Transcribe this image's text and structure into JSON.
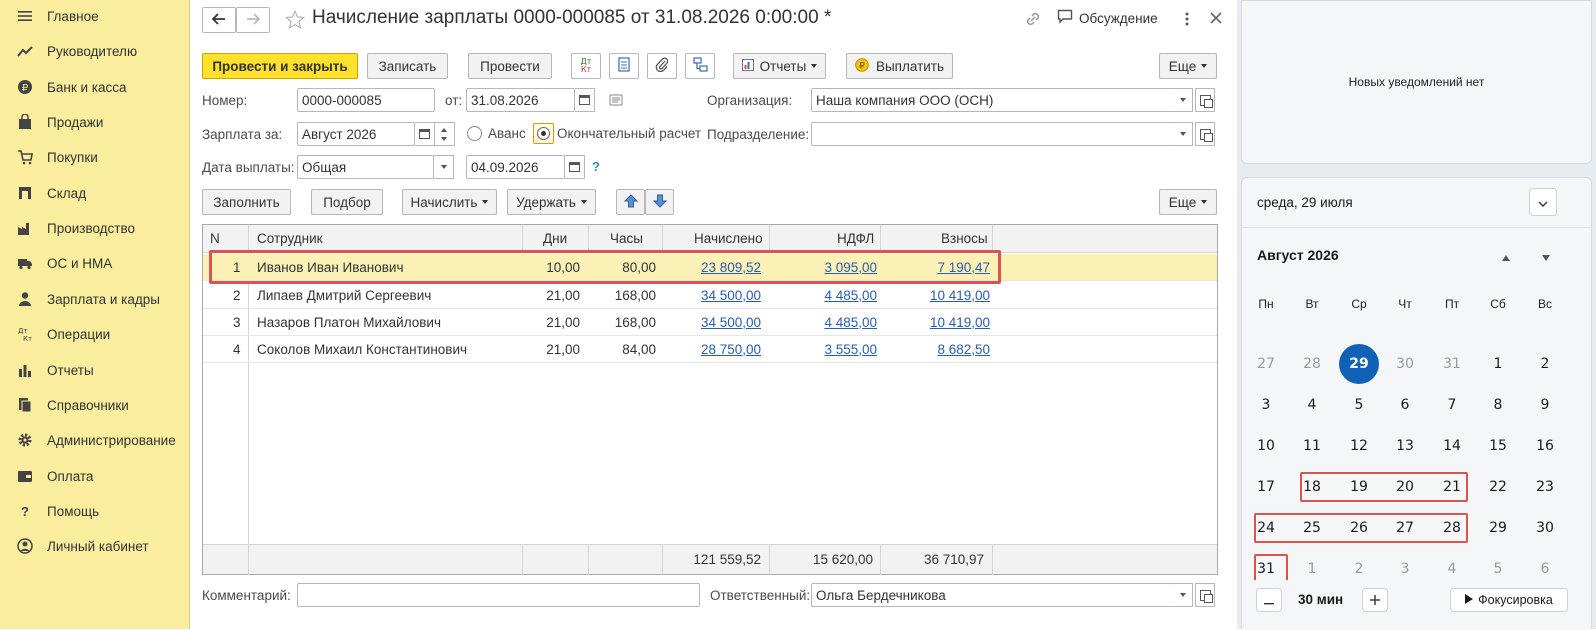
{
  "sidebar": {
    "items": [
      {
        "label": "Главное",
        "icon": "menu-icon"
      },
      {
        "label": "Руководителю",
        "icon": "trend-icon"
      },
      {
        "label": "Банк и касса",
        "icon": "ruble-coin-icon"
      },
      {
        "label": "Продажи",
        "icon": "bag-icon"
      },
      {
        "label": "Покупки",
        "icon": "cart-icon"
      },
      {
        "label": "Склад",
        "icon": "warehouse-icon"
      },
      {
        "label": "Производство",
        "icon": "factory-icon"
      },
      {
        "label": "ОС и НМА",
        "icon": "truck-icon"
      },
      {
        "label": "Зарплата и кадры",
        "icon": "person-icon"
      },
      {
        "label": "Операции",
        "icon": "dt-kt-icon"
      },
      {
        "label": "Отчеты",
        "icon": "bar-chart-icon"
      },
      {
        "label": "Справочники",
        "icon": "books-icon"
      },
      {
        "label": "Администрирование",
        "icon": "gear-icon"
      },
      {
        "label": "Оплата",
        "icon": "wallet-icon"
      },
      {
        "label": "Помощь",
        "icon": "question-icon"
      },
      {
        "label": "Личный кабинет",
        "icon": "account-icon"
      }
    ]
  },
  "doc": {
    "title": "Начисление зарплаты 0000-000085 от 31.08.2026 0:00:00 *",
    "discussion": "Обсуждение"
  },
  "toolbar": {
    "post_close": "Провести и закрыть",
    "save": "Записать",
    "post": "Провести",
    "dtkt_top": "Дт",
    "dtkt_bottom": "Кт",
    "reports": "Отчеты",
    "pay": "Выплатить",
    "more": "Еще"
  },
  "form": {
    "number_label": "Номер:",
    "number": "0000-000085",
    "from_label": "от:",
    "date": "31.08.2026",
    "org_label": "Организация:",
    "org": "Наша компания ООО (ОСН)",
    "salary_for_label": "Зарплата за:",
    "period": "Август 2026",
    "advance_label": "Аванс",
    "final_label": "Окончательный расчет",
    "dept_label": "Подразделение:",
    "dept": "",
    "pay_date_label": "Дата выплаты:",
    "pay_type": "Общая",
    "pay_date": "04.09.2026",
    "help": "?",
    "comment_label": "Комментарий:",
    "comment": "",
    "responsible_label": "Ответственный:",
    "responsible": "Ольга Бердечникова"
  },
  "table_toolbar": {
    "fill": "Заполнить",
    "pick": "Подбор",
    "accrue": "Начислить",
    "withhold": "Удержать",
    "more": "Еще"
  },
  "table": {
    "columns": [
      "N",
      "Сотрудник",
      "Дни",
      "Часы",
      "Начислено",
      "НДФЛ",
      "Взносы"
    ],
    "rows": [
      {
        "n": "1",
        "name": "Иванов Иван Иванович",
        "days": "10,00",
        "hours": "80,00",
        "accrued": "23 809,52",
        "ndfl": "3 095,00",
        "contrib": "7 190,47"
      },
      {
        "n": "2",
        "name": "Липаев Дмитрий Сергеевич",
        "days": "21,00",
        "hours": "168,00",
        "accrued": "34 500,00",
        "ndfl": "4 485,00",
        "contrib": "10 419,00"
      },
      {
        "n": "3",
        "name": "Назаров Платон Михайлович",
        "days": "21,00",
        "hours": "168,00",
        "accrued": "34 500,00",
        "ndfl": "4 485,00",
        "contrib": "10 419,00"
      },
      {
        "n": "4",
        "name": "Соколов Михаил Константинович",
        "days": "21,00",
        "hours": "84,00",
        "accrued": "28 750,00",
        "ndfl": "3 555,00",
        "contrib": "8 682,50"
      }
    ],
    "totals": {
      "accrued": "121 559,52",
      "ndfl": "15 620,00",
      "contrib": "36 710,97"
    }
  },
  "panel": {
    "notifications": "Новых уведомлений нет",
    "today": "среда, 29 июля",
    "month": "Август 2026",
    "weekdays": [
      "Пн",
      "Вт",
      "Ср",
      "Чт",
      "Пт",
      "Сб",
      "Вс"
    ],
    "weeks": [
      [
        "27",
        "28",
        "29",
        "30",
        "31",
        "1",
        "2"
      ],
      [
        "3",
        "4",
        "5",
        "6",
        "7",
        "8",
        "9"
      ],
      [
        "10",
        "11",
        "12",
        "13",
        "14",
        "15",
        "16"
      ],
      [
        "17",
        "18",
        "19",
        "20",
        "21",
        "22",
        "23"
      ],
      [
        "24",
        "25",
        "26",
        "27",
        "28",
        "29",
        "30"
      ],
      [
        "31",
        "1",
        "2",
        "3",
        "4",
        "5",
        "6"
      ]
    ],
    "focus_minutes": "30 мин",
    "focus_button": "Фокусировка"
  },
  "colors": {
    "sidebar_bg": "#fbed9e",
    "primary_button": "#ffe02b",
    "selected_row": "#fbf0b5",
    "link": "#2a5db0",
    "highlight_box": "#d9534f",
    "today_circle": "#0f62b8"
  }
}
